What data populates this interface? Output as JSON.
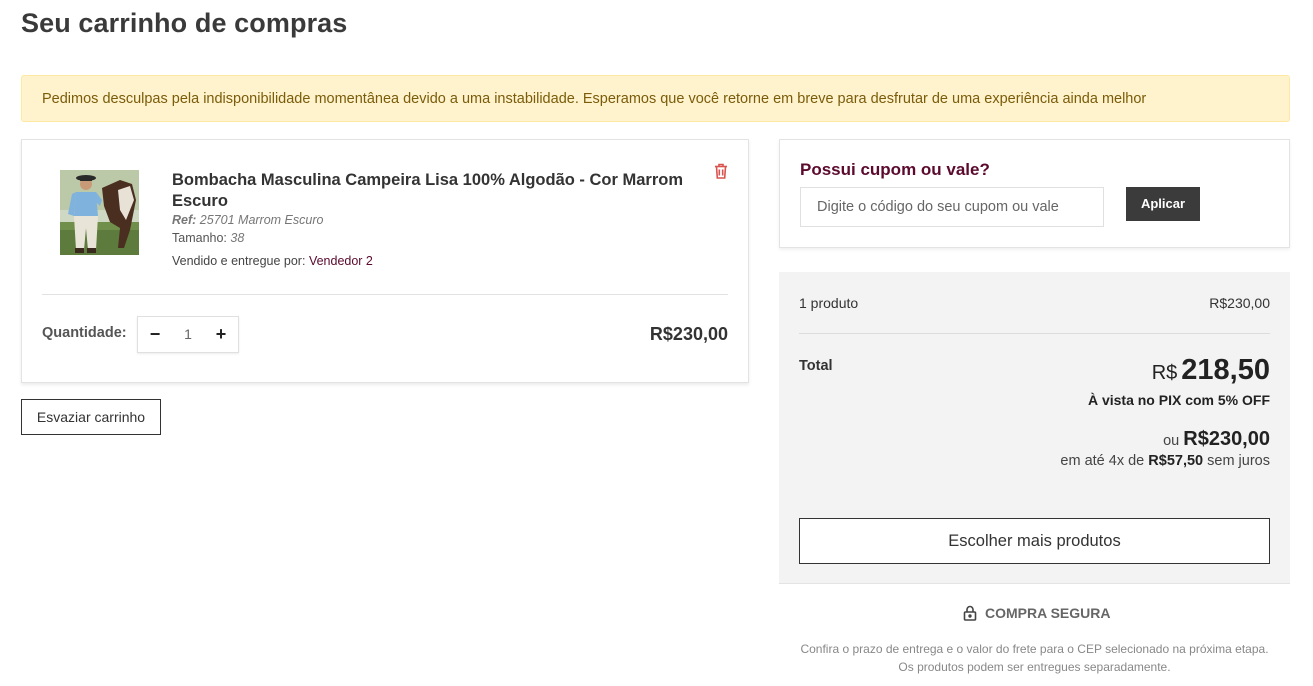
{
  "page": {
    "title": "Seu carrinho de compras"
  },
  "alert": {
    "message": "Pedimos desculpas pela indisponibilidade momentânea devido a uma instabilidade. Esperamos que você retorne em breve para desfrutar de uma experiência ainda melhor"
  },
  "cart": {
    "item": {
      "name": "Bombacha Masculina Campeira Lisa 100% Algodão - Cor Marrom Escuro",
      "ref_label": "Ref:",
      "ref_value": "25701 Marrom Escuro",
      "size_label": "Tamanho:",
      "size_value": "38",
      "seller_label": "Vendido e entregue por:",
      "seller_name": "Vendedor 2",
      "quantity_label": "Quantidade:",
      "quantity": "1",
      "minus": "−",
      "plus": "+",
      "price": "R$230,00"
    },
    "empty_button": "Esvaziar carrinho"
  },
  "coupon": {
    "title": "Possui cupom ou vale?",
    "placeholder": "Digite o código do seu cupom ou vale",
    "apply_button": "Aplicar"
  },
  "summary": {
    "count": "1 produto",
    "subtotal": "R$230,00",
    "total_label": "Total",
    "currency": "R$",
    "pix_total": "218,50",
    "pix_note": "À vista no PIX com 5% OFF",
    "or": "ou",
    "installment_total": "R$230,00",
    "installment_prefix": "em até 4x de",
    "installment_value": "R$57,50",
    "installment_suffix": "sem juros",
    "more_button": "Escolher mais produtos"
  },
  "secure": {
    "label": "COMPRA SEGURA"
  },
  "footer": {
    "line1": "Confira o prazo de entrega e o valor do frete para o CEP selecionado na próxima etapa.",
    "line2": "Os produtos podem ser entregues separadamente."
  },
  "colors": {
    "accent": "#5b0a2e",
    "alert_bg": "#fff3cd",
    "trash": "#d9534f",
    "summary_bg": "#f3f3f3"
  }
}
